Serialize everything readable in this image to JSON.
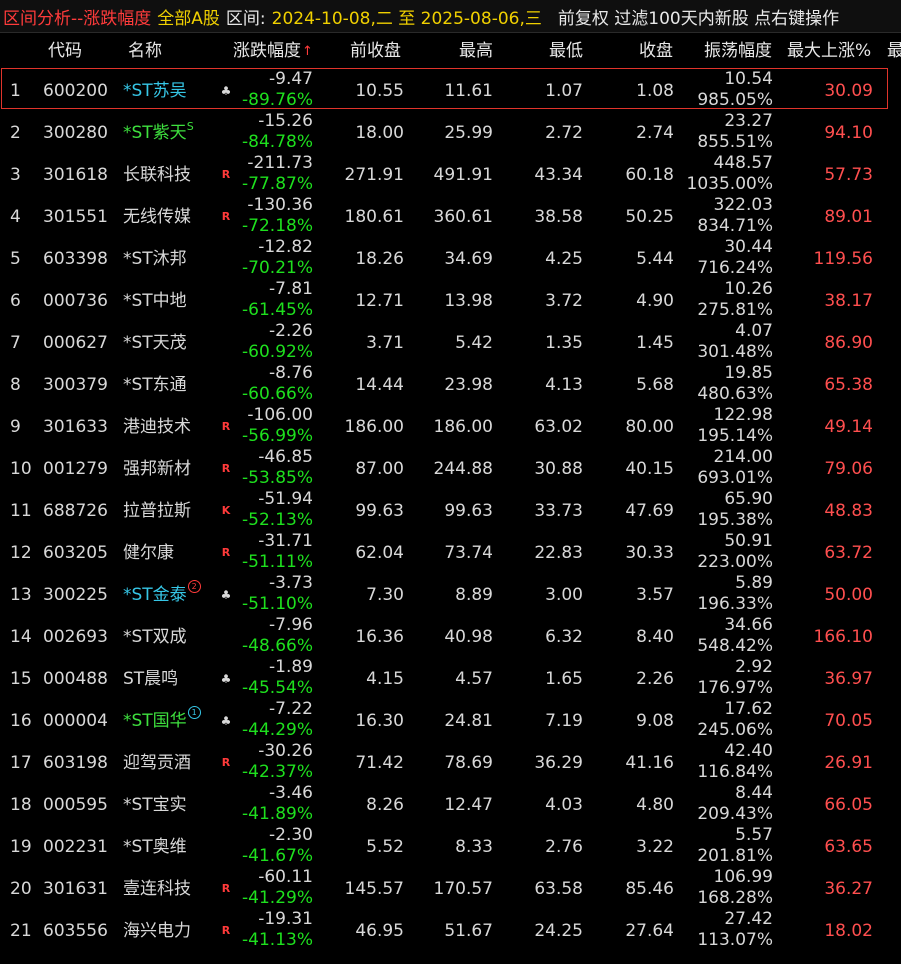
{
  "title": {
    "app": "区间分析--涨跌幅度",
    "scope": "全部A股",
    "range_label": "区间:",
    "range_value": "2024-10-08,二 至 2025-08-06,三",
    "options": "前复权 过滤100天内新股 点右键操作"
  },
  "columns": {
    "code": "代码",
    "name": "名称",
    "change": "涨跌幅度",
    "sort_indicator": "↑",
    "prev_close": "前收盘",
    "high": "最高",
    "low": "最低",
    "close": "收盘",
    "amplitude": "振荡幅度",
    "max_rise": "最大上涨%",
    "extra": "最"
  },
  "colors": {
    "red": "#ff4d4d",
    "green": "#1ee01e",
    "cyan": "#36c6e6",
    "selection_border": "#e0342b"
  },
  "rows": [
    {
      "idx": "1",
      "code": "600200",
      "name": "*ST苏吴",
      "name_color": "cyan",
      "flag": "♣",
      "chg": "-9.47",
      "pct": "-89.76%",
      "prev": "10.55",
      "high": "11.61",
      "low": "1.07",
      "close": "1.08",
      "amp": "10.54",
      "amp_pct": "985.05%",
      "maxup": "30.09",
      "selected": true
    },
    {
      "idx": "2",
      "code": "300280",
      "name": "*ST紫天",
      "name_color": "green",
      "sup": "S",
      "flag": "",
      "chg": "-15.26",
      "pct": "-84.78%",
      "prev": "18.00",
      "high": "25.99",
      "low": "2.72",
      "close": "2.74",
      "amp": "23.27",
      "amp_pct": "855.51%",
      "maxup": "94.10"
    },
    {
      "idx": "3",
      "code": "301618",
      "name": "长联科技",
      "name_color": "white",
      "flag": "R",
      "chg": "-211.73",
      "pct": "-77.87%",
      "prev": "271.91",
      "high": "491.91",
      "low": "43.34",
      "close": "60.18",
      "amp": "448.57",
      "amp_pct": "1035.00%",
      "maxup": "57.73"
    },
    {
      "idx": "4",
      "code": "301551",
      "name": "无线传媒",
      "name_color": "white",
      "flag": "R",
      "chg": "-130.36",
      "pct": "-72.18%",
      "prev": "180.61",
      "high": "360.61",
      "low": "38.58",
      "close": "50.25",
      "amp": "322.03",
      "amp_pct": "834.71%",
      "maxup": "89.01"
    },
    {
      "idx": "5",
      "code": "603398",
      "name": "*ST沐邦",
      "name_color": "white",
      "flag": "",
      "chg": "-12.82",
      "pct": "-70.21%",
      "prev": "18.26",
      "high": "34.69",
      "low": "4.25",
      "close": "5.44",
      "amp": "30.44",
      "amp_pct": "716.24%",
      "maxup": "119.56"
    },
    {
      "idx": "6",
      "code": "000736",
      "name": "*ST中地",
      "name_color": "white",
      "flag": "",
      "chg": "-7.81",
      "pct": "-61.45%",
      "prev": "12.71",
      "high": "13.98",
      "low": "3.72",
      "close": "4.90",
      "amp": "10.26",
      "amp_pct": "275.81%",
      "maxup": "38.17"
    },
    {
      "idx": "7",
      "code": "000627",
      "name": "*ST天茂",
      "name_color": "white",
      "flag": "",
      "chg": "-2.26",
      "pct": "-60.92%",
      "prev": "3.71",
      "high": "5.42",
      "low": "1.35",
      "close": "1.45",
      "amp": "4.07",
      "amp_pct": "301.48%",
      "maxup": "86.90"
    },
    {
      "idx": "8",
      "code": "300379",
      "name": "*ST东通",
      "name_color": "white",
      "flag": "",
      "chg": "-8.76",
      "pct": "-60.66%",
      "prev": "14.44",
      "high": "23.98",
      "low": "4.13",
      "close": "5.68",
      "amp": "19.85",
      "amp_pct": "480.63%",
      "maxup": "65.38"
    },
    {
      "idx": "9",
      "code": "301633",
      "name": "港迪技术",
      "name_color": "white",
      "flag": "R",
      "chg": "-106.00",
      "pct": "-56.99%",
      "prev": "186.00",
      "high": "186.00",
      "low": "63.02",
      "close": "80.00",
      "amp": "122.98",
      "amp_pct": "195.14%",
      "maxup": "49.14"
    },
    {
      "idx": "10",
      "code": "001279",
      "name": "强邦新材",
      "name_color": "white",
      "flag": "R",
      "chg": "-46.85",
      "pct": "-53.85%",
      "prev": "87.00",
      "high": "244.88",
      "low": "30.88",
      "close": "40.15",
      "amp": "214.00",
      "amp_pct": "693.01%",
      "maxup": "79.06"
    },
    {
      "idx": "11",
      "code": "688726",
      "name": "拉普拉斯",
      "name_color": "white",
      "flag": "K",
      "chg": "-51.94",
      "pct": "-52.13%",
      "prev": "99.63",
      "high": "99.63",
      "low": "33.73",
      "close": "47.69",
      "amp": "65.90",
      "amp_pct": "195.38%",
      "maxup": "48.83"
    },
    {
      "idx": "12",
      "code": "603205",
      "name": "健尔康",
      "name_color": "white",
      "flag": "R",
      "chg": "-31.71",
      "pct": "-51.11%",
      "prev": "62.04",
      "high": "73.74",
      "low": "22.83",
      "close": "30.33",
      "amp": "50.91",
      "amp_pct": "223.00%",
      "maxup": "63.72"
    },
    {
      "idx": "13",
      "code": "300225",
      "name": "*ST金泰",
      "name_color": "cyan",
      "circ": "2",
      "circ_color": "red",
      "flag": "♣",
      "chg": "-3.73",
      "pct": "-51.10%",
      "prev": "7.30",
      "high": "8.89",
      "low": "3.00",
      "close": "3.57",
      "amp": "5.89",
      "amp_pct": "196.33%",
      "maxup": "50.00"
    },
    {
      "idx": "14",
      "code": "002693",
      "name": "*ST双成",
      "name_color": "white",
      "flag": "",
      "chg": "-7.96",
      "pct": "-48.66%",
      "prev": "16.36",
      "high": "40.98",
      "low": "6.32",
      "close": "8.40",
      "amp": "34.66",
      "amp_pct": "548.42%",
      "maxup": "166.10"
    },
    {
      "idx": "15",
      "code": "000488",
      "name": "ST晨鸣",
      "name_color": "white",
      "flag": "♣",
      "chg": "-1.89",
      "pct": "-45.54%",
      "prev": "4.15",
      "high": "4.57",
      "low": "1.65",
      "close": "2.26",
      "amp": "2.92",
      "amp_pct": "176.97%",
      "maxup": "36.97"
    },
    {
      "idx": "16",
      "code": "000004",
      "name": "*ST国华",
      "name_color": "green",
      "circ": "1",
      "circ_color": "cyan",
      "flag": "♣",
      "chg": "-7.22",
      "pct": "-44.29%",
      "prev": "16.30",
      "high": "24.81",
      "low": "7.19",
      "close": "9.08",
      "amp": "17.62",
      "amp_pct": "245.06%",
      "maxup": "70.05"
    },
    {
      "idx": "17",
      "code": "603198",
      "name": "迎驾贡酒",
      "name_color": "white",
      "flag": "R",
      "chg": "-30.26",
      "pct": "-42.37%",
      "prev": "71.42",
      "high": "78.69",
      "low": "36.29",
      "close": "41.16",
      "amp": "42.40",
      "amp_pct": "116.84%",
      "maxup": "26.91"
    },
    {
      "idx": "18",
      "code": "000595",
      "name": "*ST宝实",
      "name_color": "white",
      "flag": "",
      "chg": "-3.46",
      "pct": "-41.89%",
      "prev": "8.26",
      "high": "12.47",
      "low": "4.03",
      "close": "4.80",
      "amp": "8.44",
      "amp_pct": "209.43%",
      "maxup": "66.05"
    },
    {
      "idx": "19",
      "code": "002231",
      "name": "*ST奥维",
      "name_color": "white",
      "flag": "",
      "chg": "-2.30",
      "pct": "-41.67%",
      "prev": "5.52",
      "high": "8.33",
      "low": "2.76",
      "close": "3.22",
      "amp": "5.57",
      "amp_pct": "201.81%",
      "maxup": "63.65"
    },
    {
      "idx": "20",
      "code": "301631",
      "name": "壹连科技",
      "name_color": "white",
      "flag": "R",
      "chg": "-60.11",
      "pct": "-41.29%",
      "prev": "145.57",
      "high": "170.57",
      "low": "63.58",
      "close": "85.46",
      "amp": "106.99",
      "amp_pct": "168.28%",
      "maxup": "36.27"
    },
    {
      "idx": "21",
      "code": "603556",
      "name": "海兴电力",
      "name_color": "white",
      "flag": "R",
      "chg": "-19.31",
      "pct": "-41.13%",
      "prev": "46.95",
      "high": "51.67",
      "low": "24.25",
      "close": "27.64",
      "amp": "27.42",
      "amp_pct": "113.07%",
      "maxup": "18.02"
    }
  ]
}
